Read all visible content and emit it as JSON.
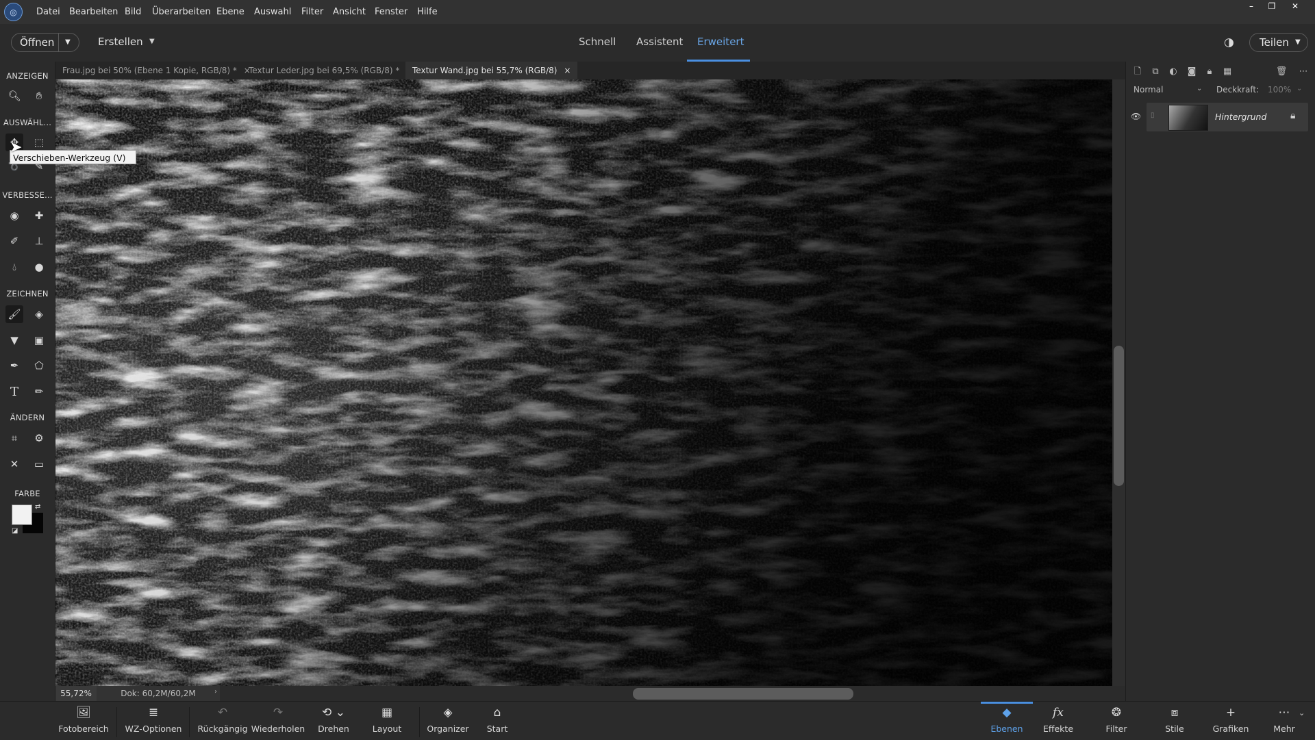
{
  "menubar": {
    "items": [
      "Datei",
      "Bearbeiten",
      "Bild",
      "Überarbeiten",
      "Ebene",
      "Auswahl",
      "Filter",
      "Ansicht",
      "Fenster",
      "Hilfe"
    ],
    "window_controls": [
      "–",
      "❐",
      "✕"
    ]
  },
  "header": {
    "open_label": "Öffnen",
    "create_label": "Erstellen",
    "modes": [
      "Schnell",
      "Assistent",
      "Erweitert"
    ],
    "active_mode": "Erweitert",
    "share_label": "Teilen"
  },
  "doc_tabs": [
    {
      "label": "Frau.jpg bei 50% (Ebene 1 Kopie, RGB/8) *",
      "active": false
    },
    {
      "label": "Textur Leder.jpg bei 69,5% (RGB/8) *",
      "active": false
    },
    {
      "label": "Textur Wand.jpg bei 55,7% (RGB/8)",
      "active": true
    }
  ],
  "toolbox": {
    "sections": {
      "view": "ANZEIGEN",
      "select": "AUSWÄHL...",
      "enhance": "VERBESSE...",
      "draw": "ZEICHNEN",
      "modify": "ÄNDERN",
      "color": "FARBE"
    },
    "tooltip": "Verschieben-Werkzeug (V)",
    "foreground_color": "#f2f2f2",
    "background_color": "#050505"
  },
  "status": {
    "zoom": "55,72%",
    "doc_size": "Dok: 60,2M/60,2M"
  },
  "layers_panel": {
    "blend_mode": "Normal",
    "opacity_label": "Deckkraft:",
    "opacity_value": "100%",
    "layer_name": "Hintergrund"
  },
  "bottom_bar": {
    "left": [
      "Fotobereich",
      "WZ-Optionen",
      "Rückgängig",
      "Wiederholen",
      "Drehen",
      "Layout",
      "Organizer",
      "Start"
    ],
    "right": [
      "Ebenen",
      "Effekte",
      "Filter",
      "Stile",
      "Grafiken",
      "Mehr"
    ],
    "active_right": "Ebenen"
  }
}
